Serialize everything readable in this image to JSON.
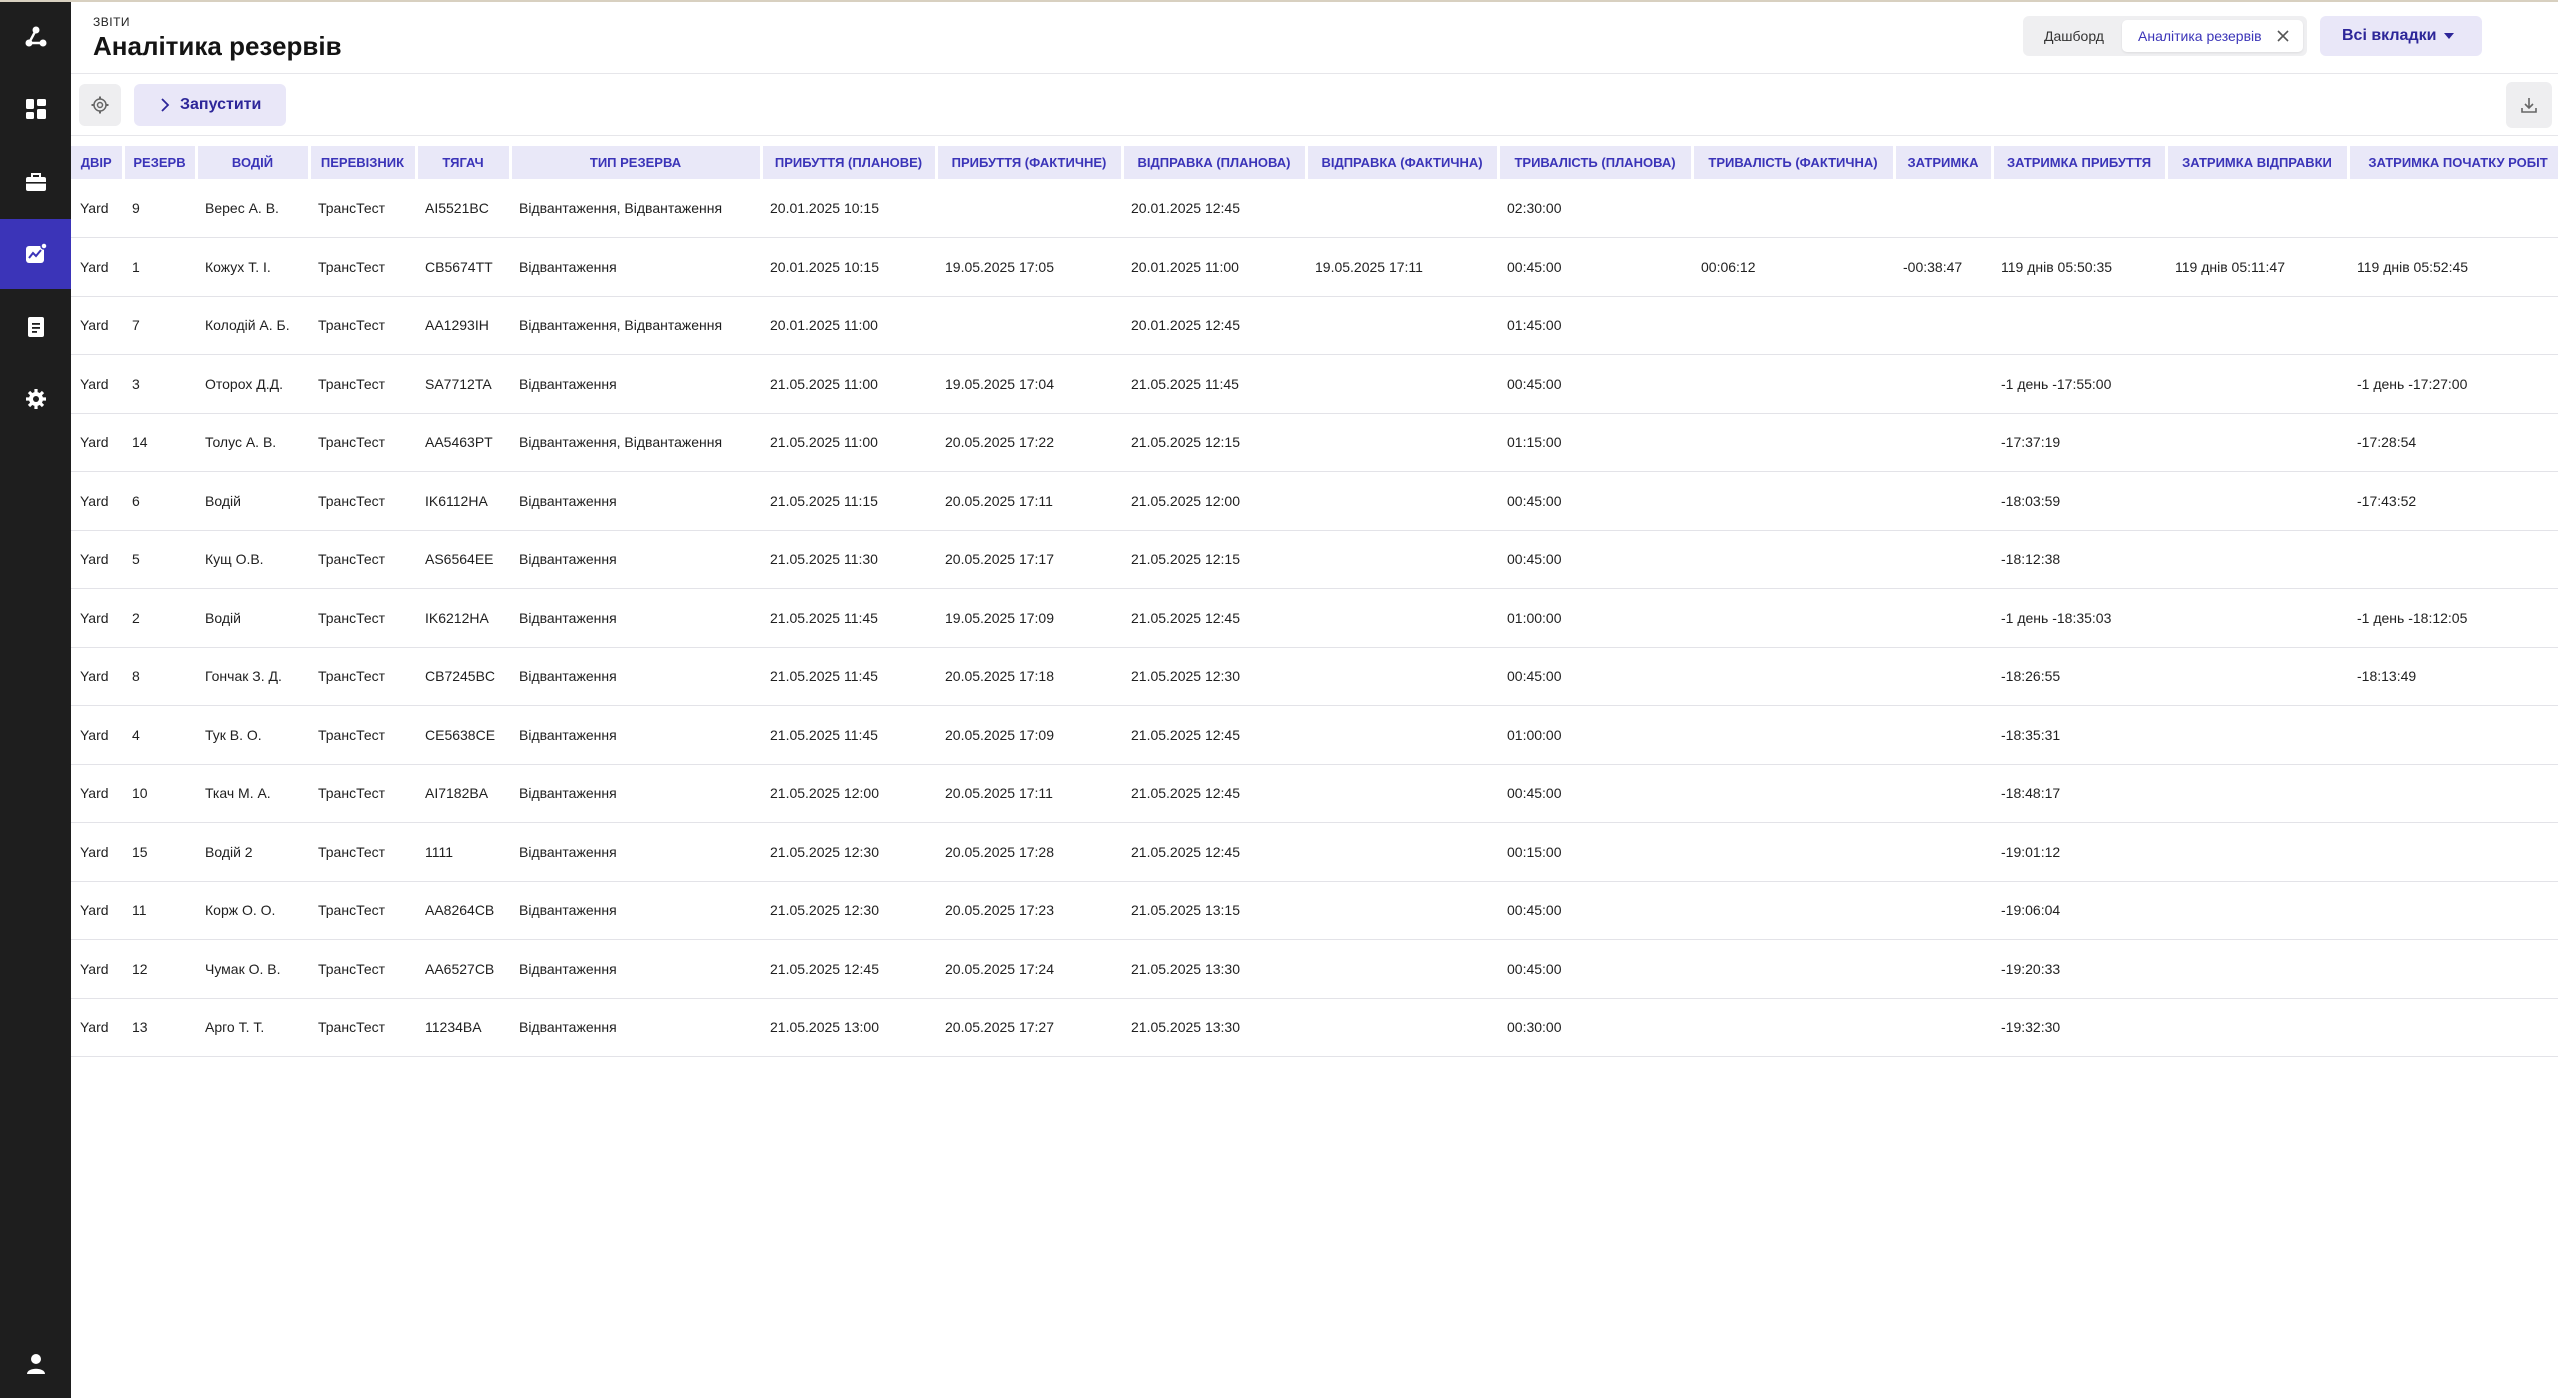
{
  "header": {
    "breadcrumb": "ЗВІТИ",
    "title": "Аналітика резервів",
    "tabs": [
      {
        "label": "Дашборд",
        "active": false
      },
      {
        "label": "Аналітика резервів",
        "active": true
      }
    ],
    "all_tabs_label": "Всі вкладки"
  },
  "sidebar": {
    "items": [
      {
        "icon": "logo-icon"
      },
      {
        "icon": "dashboard-icon"
      },
      {
        "icon": "briefcase-icon"
      },
      {
        "icon": "analytics-icon",
        "active": true
      },
      {
        "icon": "document-icon"
      },
      {
        "icon": "gear-icon"
      },
      {
        "icon": "user-icon"
      }
    ]
  },
  "toolbar": {
    "run_label": "Запустити"
  },
  "colors": {
    "accent": "#3b34b8",
    "accent_light": "#e9e8f8",
    "sidebar_bg": "#1e1e1e"
  },
  "table": {
    "columns": [
      "ДВІР",
      "РЕЗЕРВ",
      "ВОДІЙ",
      "ПЕРЕВІЗНИК",
      "ТЯГАЧ",
      "ТИП РЕЗЕРВА",
      "ПРИБУТТЯ (ПЛАНОВЕ)",
      "ПРИБУТТЯ (ФАКТИЧНЕ)",
      "ВІДПРАВКА (ПЛАНОВА)",
      "ВІДПРАВКА (ФАКТИЧНА)",
      "ТРИВАЛІСТЬ (ПЛАНОВА)",
      "ТРИВАЛІСТЬ (ФАКТИЧНА)",
      "ЗАТРИМКА",
      "ЗАТРИМКА ПРИБУТТЯ",
      "ЗАТРИМКА ВІДПРАВКИ",
      "ЗАТРИМКА ПОЧАТКУ РОБІТ"
    ],
    "rows": [
      [
        "Yard",
        "9",
        "Верес А. В.",
        "ТрансТест",
        "AI5521BC",
        "Відвантаження, Відвантаження",
        "20.01.2025 10:15",
        "",
        "20.01.2025 12:45",
        "",
        "02:30:00",
        "",
        "",
        "",
        "",
        ""
      ],
      [
        "Yard",
        "1",
        "Кожух Т. І.",
        "ТрансТест",
        "CB5674TT",
        "Відвантаження",
        "20.01.2025 10:15",
        "19.05.2025 17:05",
        "20.01.2025 11:00",
        "19.05.2025 17:11",
        "00:45:00",
        "00:06:12",
        "-00:38:47",
        "119 днів 05:50:35",
        "119 днів 05:11:47",
        "119 днів 05:52:45"
      ],
      [
        "Yard",
        "7",
        "Колодій А. Б.",
        "ТрансТест",
        "AA1293IH",
        "Відвантаження, Відвантаження",
        "20.01.2025 11:00",
        "",
        "20.01.2025 12:45",
        "",
        "01:45:00",
        "",
        "",
        "",
        "",
        ""
      ],
      [
        "Yard",
        "3",
        "Оторох Д.Д.",
        "ТрансТест",
        "SA7712TA",
        "Відвантаження",
        "21.05.2025 11:00",
        "19.05.2025 17:04",
        "21.05.2025 11:45",
        "",
        "00:45:00",
        "",
        "",
        "-1 день -17:55:00",
        "",
        "-1 день -17:27:00"
      ],
      [
        "Yard",
        "14",
        "Толус А. В.",
        "ТрансТест",
        "AA5463PT",
        "Відвантаження, Відвантаження",
        "21.05.2025 11:00",
        "20.05.2025 17:22",
        "21.05.2025 12:15",
        "",
        "01:15:00",
        "",
        "",
        "-17:37:19",
        "",
        "-17:28:54"
      ],
      [
        "Yard",
        "6",
        "Водій",
        "ТрансТест",
        "IK6112HA",
        "Відвантаження",
        "21.05.2025 11:15",
        "20.05.2025 17:11",
        "21.05.2025 12:00",
        "",
        "00:45:00",
        "",
        "",
        "-18:03:59",
        "",
        "-17:43:52"
      ],
      [
        "Yard",
        "5",
        "Кущ О.В.",
        "ТрансТест",
        "AS6564EE",
        "Відвантаження",
        "21.05.2025 11:30",
        "20.05.2025 17:17",
        "21.05.2025 12:15",
        "",
        "00:45:00",
        "",
        "",
        "-18:12:38",
        "",
        ""
      ],
      [
        "Yard",
        "2",
        "Водій",
        "ТрансТест",
        "IK6212HA",
        "Відвантаження",
        "21.05.2025 11:45",
        "19.05.2025 17:09",
        "21.05.2025 12:45",
        "",
        "01:00:00",
        "",
        "",
        "-1 день -18:35:03",
        "",
        "-1 день -18:12:05"
      ],
      [
        "Yard",
        "8",
        "Гончак З. Д.",
        "ТрансТест",
        "CB7245BC",
        "Відвантаження",
        "21.05.2025 11:45",
        "20.05.2025 17:18",
        "21.05.2025 12:30",
        "",
        "00:45:00",
        "",
        "",
        "-18:26:55",
        "",
        "-18:13:49"
      ],
      [
        "Yard",
        "4",
        "Тук В. О.",
        "ТрансТест",
        "CE5638CE",
        "Відвантаження",
        "21.05.2025 11:45",
        "20.05.2025 17:09",
        "21.05.2025 12:45",
        "",
        "01:00:00",
        "",
        "",
        "-18:35:31",
        "",
        ""
      ],
      [
        "Yard",
        "10",
        "Ткач М. А.",
        "ТрансТест",
        "AI7182BA",
        "Відвантаження",
        "21.05.2025 12:00",
        "20.05.2025 17:11",
        "21.05.2025 12:45",
        "",
        "00:45:00",
        "",
        "",
        "-18:48:17",
        "",
        ""
      ],
      [
        "Yard",
        "15",
        "Водій 2",
        "ТрансТест",
        "1111",
        "Відвантаження",
        "21.05.2025 12:30",
        "20.05.2025 17:28",
        "21.05.2025 12:45",
        "",
        "00:15:00",
        "",
        "",
        "-19:01:12",
        "",
        ""
      ],
      [
        "Yard",
        "11",
        "Корж О. О.",
        "ТрансТест",
        "AA8264CB",
        "Відвантаження",
        "21.05.2025 12:30",
        "20.05.2025 17:23",
        "21.05.2025 13:15",
        "",
        "00:45:00",
        "",
        "",
        "-19:06:04",
        "",
        ""
      ],
      [
        "Yard",
        "12",
        "Чумак О. В.",
        "ТрансТест",
        "AA6527CB",
        "Відвантаження",
        "21.05.2025 12:45",
        "20.05.2025 17:24",
        "21.05.2025 13:30",
        "",
        "00:45:00",
        "",
        "",
        "-19:20:33",
        "",
        ""
      ],
      [
        "Yard",
        "13",
        "Арго Т. Т.",
        "ТрансТест",
        "11234BA",
        "Відвантаження",
        "21.05.2025 13:00",
        "20.05.2025 17:27",
        "21.05.2025 13:30",
        "",
        "00:30:00",
        "",
        "",
        "-19:32:30",
        "",
        ""
      ]
    ]
  }
}
